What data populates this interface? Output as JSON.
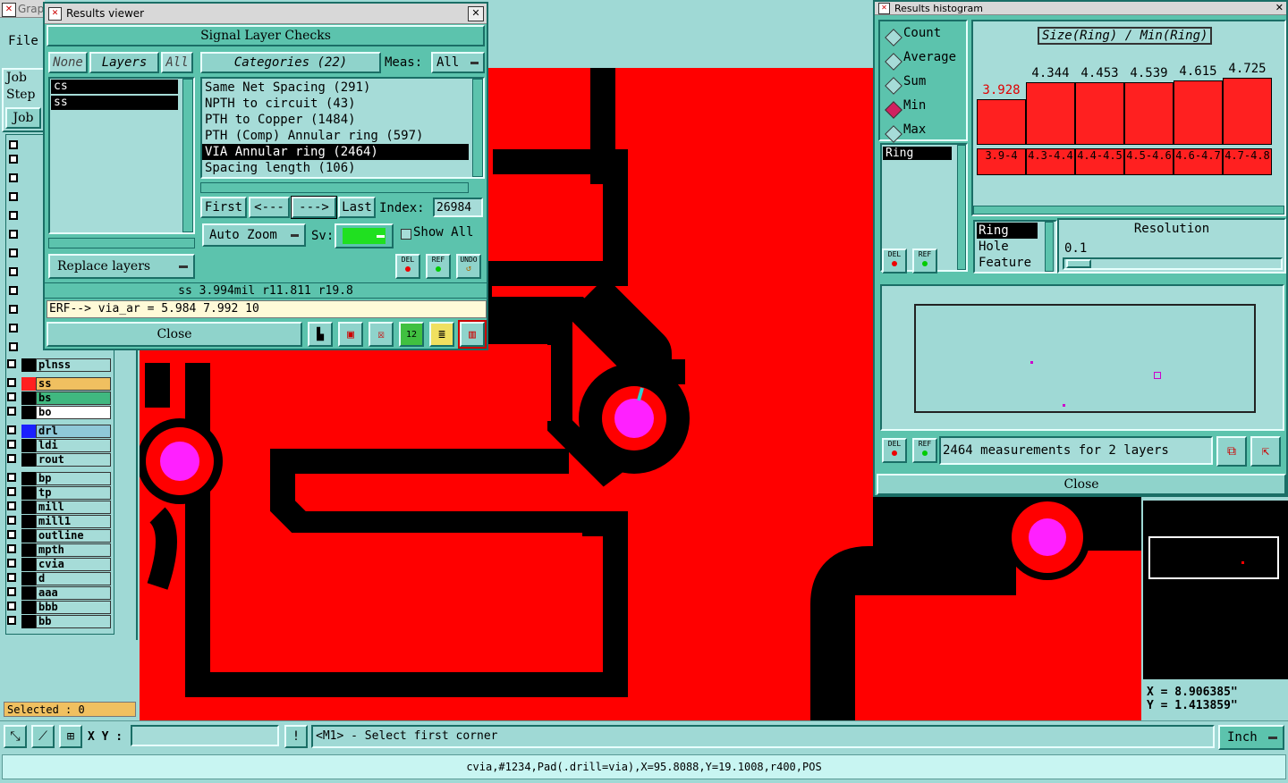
{
  "graphic_app": {
    "title_fragment": "Grap",
    "menu_file": "File",
    "job_label": "Job",
    "step_label": "Step",
    "job_button": "Job",
    "selected_label": "Selected : 0",
    "layers": [
      {
        "name": "plnss",
        "color": "#000000"
      },
      {
        "name": "ss",
        "color": "#ff2020"
      },
      {
        "name": "bs",
        "color": "#000000"
      },
      {
        "name": "bo",
        "color": "#000000"
      },
      {
        "name": "drl",
        "color": "#1a20ff"
      },
      {
        "name": "ldi",
        "color": "#000000"
      },
      {
        "name": "rout",
        "color": "#000000"
      },
      {
        "name": "bp",
        "color": "#000000"
      },
      {
        "name": "tp",
        "color": "#000000"
      },
      {
        "name": "mill",
        "color": "#000000"
      },
      {
        "name": "mill1",
        "color": "#000000"
      },
      {
        "name": "outline",
        "color": "#000000"
      },
      {
        "name": "mpth",
        "color": "#000000"
      },
      {
        "name": "cvia",
        "color": "#000000"
      },
      {
        "name": "d",
        "color": "#000000"
      },
      {
        "name": "aaa",
        "color": "#000000"
      },
      {
        "name": "bbb",
        "color": "#000000"
      },
      {
        "name": "bb",
        "color": "#000000"
      }
    ],
    "xy_label": "X Y :",
    "xy_value": "",
    "prompt": "<M1> - Select first corner",
    "units": "Inch",
    "coord_x": "X = 8.906385\"",
    "coord_y": "Y = 1.413859\"",
    "status_line": "cvia,#1234,Pad(.drill=via),X=95.8088,Y=19.1008,r400,POS"
  },
  "results_viewer": {
    "title": "Results viewer",
    "header": "Signal Layer Checks",
    "none_button": "None",
    "layers_button": "Layers",
    "all_button": "All",
    "categories_button": "Categories (22)",
    "meas_label": "Meas:",
    "meas_value": "All",
    "layer_list": [
      "cs",
      "ss"
    ],
    "categories": [
      {
        "label": "Same Net Spacing (291)",
        "selected": false
      },
      {
        "label": "NPTH to circuit (43)",
        "selected": false
      },
      {
        "label": "PTH to Copper (1484)",
        "selected": false
      },
      {
        "label": "PTH (Comp) Annular ring (597)",
        "selected": false
      },
      {
        "label": "VIA Annular ring (2464)",
        "selected": true
      },
      {
        "label": "Spacing length (106)",
        "selected": false
      }
    ],
    "first_button": "First",
    "prev_button": "<---",
    "next_button": "--->",
    "last_button": "Last",
    "index_label": "Index:",
    "index_value": "26984",
    "auto_zoom": "Auto Zoom",
    "sv_label": "Sv:",
    "show_all": "Show All",
    "replace_layers": "Replace layers",
    "del_label": "DEL",
    "ref_label": "REF",
    "undo_label": "UNDO",
    "measurement_line": "ss 3.994mil   r11.811   r19.8",
    "erf_line": "ERF--> via_ar = 5.984 7.992 10",
    "close_button": "Close"
  },
  "histogram": {
    "title": "Results histogram",
    "stat_options": [
      {
        "label": "Count",
        "selected": false
      },
      {
        "label": "Average",
        "selected": false
      },
      {
        "label": "Sum",
        "selected": false
      },
      {
        "label": "Min",
        "selected": true
      },
      {
        "label": "Max",
        "selected": false
      }
    ],
    "field_list": [
      "Ring"
    ],
    "chart_title": "Size(Ring) / Min(Ring)",
    "bars": [
      {
        "value": "3.928",
        "range": "3.9-4",
        "highlight": true,
        "fill": 0.62
      },
      {
        "value": "4.344",
        "range": "4.3-4.4",
        "highlight": false,
        "fill": 0.85
      },
      {
        "value": "4.453",
        "range": "4.4-4.5",
        "highlight": false,
        "fill": 0.85
      },
      {
        "value": "4.539",
        "range": "4.5-4.6",
        "highlight": false,
        "fill": 0.85
      },
      {
        "value": "4.615",
        "range": "4.6-4.7",
        "highlight": false,
        "fill": 0.88
      },
      {
        "value": "4.725",
        "range": "4.7-4.8",
        "highlight": false,
        "fill": 0.92
      }
    ],
    "ring_list": [
      "Ring",
      "Hole",
      "Feature"
    ],
    "resolution_label": "Resolution",
    "resolution_value": "0.1",
    "summary": "2464 measurements for 2 layers",
    "close_button": "Close",
    "del_label": "DEL",
    "ref_label": "REF"
  },
  "colors": {
    "copper": "#ff0000",
    "drill": "#ff20ff",
    "panel": "#5cc3ad"
  }
}
